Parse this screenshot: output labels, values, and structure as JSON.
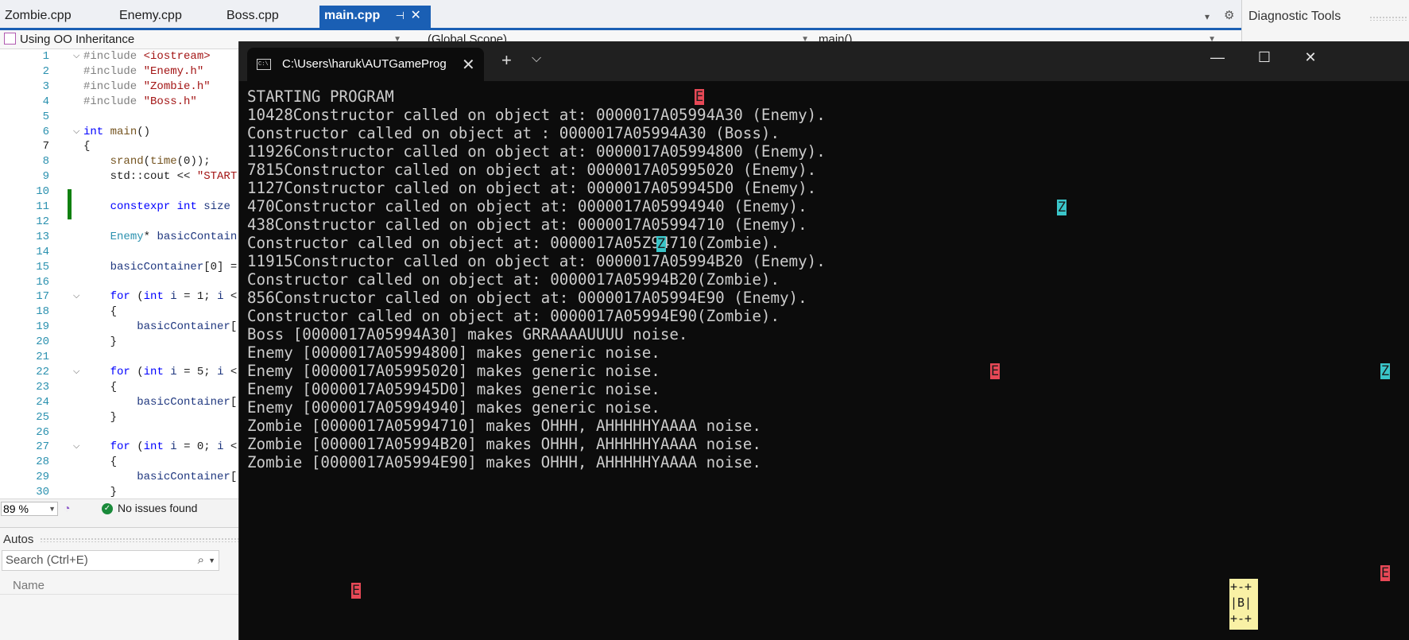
{
  "vs": {
    "tabs": [
      {
        "label": "Zombie.cpp",
        "active": false
      },
      {
        "label": "Enemy.cpp",
        "active": false
      },
      {
        "label": "Boss.cpp",
        "active": false
      },
      {
        "label": "main.cpp",
        "active": true
      }
    ],
    "diagnostic_tools": "Diagnostic Tools",
    "nav": {
      "project": "Using OO Inheritance",
      "scope": "(Global Scope)",
      "member": "main()"
    },
    "zoom": "89 %",
    "issues": "No issues found",
    "autos": {
      "title": "Autos",
      "search_placeholder": "Search (Ctrl+E)",
      "column_name": "Name"
    },
    "line_numbers": [
      "1",
      "2",
      "3",
      "4",
      "5",
      "6",
      "7",
      "8",
      "9",
      "10",
      "11",
      "12",
      "13",
      "14",
      "15",
      "16",
      "17",
      "18",
      "19",
      "20",
      "21",
      "22",
      "23",
      "24",
      "25",
      "26",
      "27",
      "28",
      "29",
      "30"
    ],
    "current_line": "7"
  },
  "terminal": {
    "tab_title": "C:\\Users\\haruk\\AUTGameProg",
    "lines": [
      "STARTING PROGRAM",
      "10428Constructor called on object at: 0000017A05994A30 (Enemy).",
      "Constructor called on object at : 0000017A05994A30 (Boss).",
      "11926Constructor called on object at: 0000017A05994800 (Enemy).",
      "7815Constructor called on object at: 0000017A05995020 (Enemy).",
      "1127Constructor called on object at: 0000017A059945D0 (Enemy).",
      "470Constructor called on object at: 0000017A05994940 (Enemy).",
      "438Constructor called on object at: 0000017A05994710 (Enemy).",
      "Constructor called on object at: 0000017A05Z94710(Zombie).",
      "11915Constructor called on object at: 0000017A05994B20 (Enemy).",
      "Constructor called on object at: 0000017A05994B20(Zombie).",
      "856Constructor called on object at: 0000017A05994E90 (Enemy).",
      "Constructor called on object at: 0000017A05994E90(Zombie).",
      "Boss [0000017A05994A30] makes GRRAAAAUUUU noise.",
      "Enemy [0000017A05994800] makes generic noise.",
      "Enemy [0000017A05995020] makes generic noise.",
      "Enemy [0000017A059945D0] makes generic noise.",
      "Enemy [0000017A05994940] makes generic noise.",
      "Zombie [0000017A05994710] makes OHHH, AHHHHHYAAAA noise.",
      "Zombie [0000017A05994B20] makes OHHH, AHHHHHYAAAA noise.",
      "Zombie [0000017A05994E90] makes OHHH, AHHHHHYAAAA noise."
    ],
    "sprites": {
      "enemy": "E",
      "zombie": "Z",
      "boss_top": "+-+",
      "boss_mid": "|B|",
      "boss_bot": "+-+"
    },
    "colors": {
      "background": "#0c0c0c",
      "text": "#cccccc",
      "enemy": "#e74856",
      "zombie": "#3ac5c9",
      "boss": "#f9f1a5"
    }
  }
}
